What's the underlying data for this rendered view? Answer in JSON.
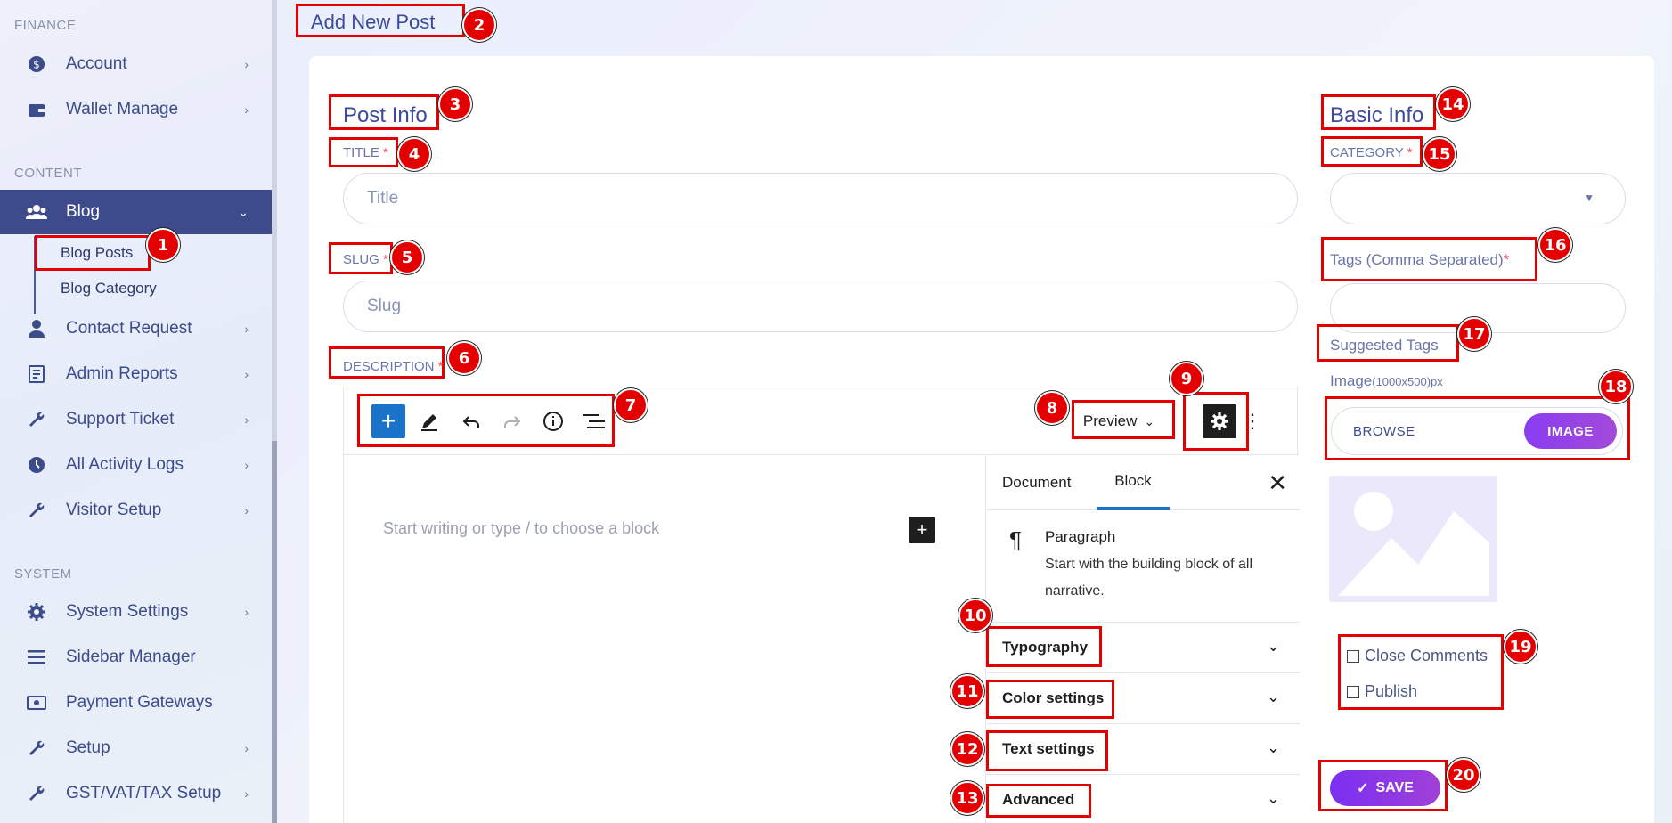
{
  "sidebar": {
    "sections": {
      "finance": "FINANCE",
      "content": "CONTENT",
      "system": "SYSTEM"
    },
    "items": {
      "account": "Account",
      "wallet": "Wallet Manage",
      "blog": "Blog",
      "contact": "Contact Request",
      "reports": "Admin Reports",
      "support": "Support Ticket",
      "activity": "All Activity Logs",
      "visitor": "Visitor Setup",
      "settings": "System Settings",
      "sidebar_manager": "Sidebar Manager",
      "payment": "Payment Gateways",
      "setup": "Setup",
      "gst": "GST/VAT/TAX Setup"
    },
    "blog_sub": {
      "posts": "Blog Posts",
      "category": "Blog Category"
    }
  },
  "page": {
    "title": "Add New Post"
  },
  "post_info": {
    "heading": "Post Info",
    "title_label": "TITLE",
    "title_placeholder": "Title",
    "slug_label": "SLUG",
    "slug_placeholder": "Slug",
    "description_label": "DESCRIPTION",
    "required_mark": "*"
  },
  "editor": {
    "preview_label": "Preview",
    "placeholder": "Start writing or type / to choose a block",
    "tabs": {
      "document": "Document",
      "block": "Block"
    },
    "block": {
      "name": "Paragraph",
      "description": "Start with the building block of all narrative."
    },
    "panels": {
      "typography": "Typography",
      "color": "Color settings",
      "text": "Text settings",
      "advanced": "Advanced"
    }
  },
  "basic_info": {
    "heading": "Basic Info",
    "category_label": "CATEGORY",
    "tags_label": "Tags (Comma Separated)",
    "suggested_tags": "Suggested Tags",
    "image_label": "Image",
    "image_size": "(1000x500)px",
    "browse": "BROWSE",
    "image_button": "IMAGE",
    "close_comments": "Close Comments",
    "publish": "Publish",
    "save": "SAVE"
  },
  "annotations": [
    "1",
    "2",
    "3",
    "4",
    "5",
    "6",
    "7",
    "8",
    "9",
    "10",
    "11",
    "12",
    "13",
    "14",
    "15",
    "16",
    "17",
    "18",
    "19",
    "20"
  ],
  "colors": {
    "accent": "#3d4a8c",
    "annotation": "#e40000",
    "button_gradient_start": "#7b2ff2",
    "editor_blue": "#1a73c8"
  }
}
